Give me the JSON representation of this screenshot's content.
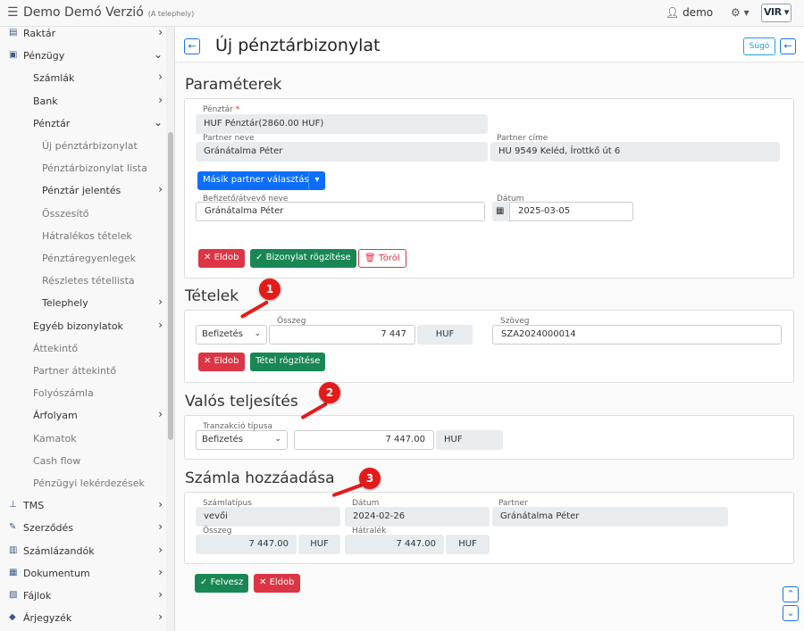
{
  "topbar": {
    "app_title": "Demo Demó Verzió",
    "site": "(A telephely)",
    "user": "demo",
    "logo": "VIR"
  },
  "sidebar": {
    "items": [
      {
        "label": "Raktár",
        "level": 0,
        "icon": "warehouse-icon",
        "chev": "›"
      },
      {
        "label": "Pénzügy",
        "level": 0,
        "icon": "money-icon",
        "chev": "⌄"
      },
      {
        "label": "Számlák",
        "level": 1,
        "chev": "›"
      },
      {
        "label": "Bank",
        "level": 1,
        "chev": "›"
      },
      {
        "label": "Pénztár",
        "level": 1,
        "chev": "⌄"
      },
      {
        "label": "Új pénztárbizonylat",
        "level": 2
      },
      {
        "label": "Pénztárbizonylat lista",
        "level": 2
      },
      {
        "label": "Pénztár jelentés",
        "level": 2,
        "chev": "›",
        "dark": true
      },
      {
        "label": "Összesítő",
        "level": 2
      },
      {
        "label": "Hátralékos tételek",
        "level": 2
      },
      {
        "label": "Pénztáregyenlegek",
        "level": 2
      },
      {
        "label": "Részletes tétellista",
        "level": 2
      },
      {
        "label": "Telephely",
        "level": 2,
        "chev": "›",
        "dark": true
      },
      {
        "label": "Egyéb bizonylatok",
        "level": 1,
        "chev": "›"
      },
      {
        "label": "Áttekintő",
        "level": 1,
        "dim": true
      },
      {
        "label": "Partner áttekintő",
        "level": 1,
        "dim": true
      },
      {
        "label": "Folyószámla",
        "level": 1,
        "dim": true
      },
      {
        "label": "Árfolyam",
        "level": 1,
        "chev": "›"
      },
      {
        "label": "Kamatok",
        "level": 1,
        "dim": true
      },
      {
        "label": "Cash flow",
        "level": 1,
        "dim": true
      },
      {
        "label": "Pénzügyi lekérdezések",
        "level": 1,
        "dim": true
      },
      {
        "label": "TMS",
        "level": 0,
        "icon": "pin-icon",
        "chev": "›"
      },
      {
        "label": "Szerződés",
        "level": 0,
        "icon": "contract-icon",
        "chev": "›"
      },
      {
        "label": "Számlázandók",
        "level": 0,
        "icon": "invoice-icon",
        "chev": "›"
      },
      {
        "label": "Dokumentum",
        "level": 0,
        "icon": "document-icon",
        "chev": "›"
      },
      {
        "label": "Fájlok",
        "level": 0,
        "icon": "file-icon",
        "chev": "›"
      },
      {
        "label": "Árjegyzék",
        "level": 0,
        "icon": "tag-icon",
        "chev": "›"
      }
    ]
  },
  "page": {
    "title": "Új pénztárbizonylat",
    "help": "Súgó"
  },
  "params": {
    "heading": "Paraméterek",
    "cashdesk_label": "Pénztár",
    "cashdesk_value": "HUF Pénztár(2860.00 HUF)",
    "partner_name_label": "Partner neve",
    "partner_name_value": "Gránátalma Péter",
    "partner_addr_label": "Partner címe",
    "partner_addr_value": "HU 9549 Keléd, Írottkő út 6",
    "choose_partner": "Másik partner választása",
    "payer_label": "Befizető/átvevő neve",
    "payer_value": "Gránátalma Péter",
    "date_label": "Dátum",
    "date_value": "2025-03-05",
    "discard": "Eldob",
    "save": "Bizonylat rögzítése",
    "delete": "Töröl"
  },
  "items": {
    "heading": "Tételek",
    "type_value": "Befizetés",
    "amount_label": "Összeg",
    "amount_value": "7 447",
    "currency": "HUF",
    "text_label": "Szöveg",
    "text_value": "SZA2024000014",
    "discard": "Eldob",
    "save": "Tétel rögzítése"
  },
  "actual": {
    "heading": "Valós teljesítés",
    "tx_label": "Tranzakció típusa",
    "tx_value": "Befizetés",
    "amount_value": "7 447.00",
    "currency": "HUF"
  },
  "invoice": {
    "heading": "Számla hozzáadása",
    "type_label": "Számlatípus",
    "type_value": "vevői",
    "date_label": "Dátum",
    "date_value": "2024-02-26",
    "partner_label": "Partner",
    "partner_value": "Gránátalma Péter",
    "amount_label": "Összeg",
    "amount_value": "7 447.00",
    "amount_currency": "HUF",
    "due_label": "Hátralék",
    "due_value": "7 447.00",
    "due_currency": "HUF"
  },
  "footer": {
    "add": "Felvesz",
    "discard": "Eldob"
  },
  "markers": [
    "1",
    "2",
    "3"
  ]
}
